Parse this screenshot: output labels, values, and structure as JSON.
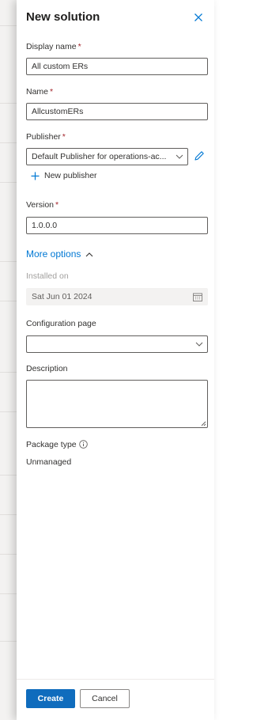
{
  "panel": {
    "title": "New solution",
    "close_icon": "close-icon"
  },
  "form": {
    "display_name": {
      "label": "Display name",
      "required": "*",
      "value": "All custom ERs"
    },
    "name": {
      "label": "Name",
      "required": "*",
      "value": "AllcustomERs"
    },
    "publisher": {
      "label": "Publisher",
      "required": "*",
      "value": "Default Publisher for operations-ac..."
    },
    "new_publisher": "New publisher",
    "version": {
      "label": "Version",
      "required": "*",
      "value": "1.0.0.0"
    },
    "more_options": "More options",
    "installed_on": {
      "label": "Installed on",
      "value": "Sat Jun 01 2024"
    },
    "configuration_page": {
      "label": "Configuration page",
      "value": ""
    },
    "description": {
      "label": "Description",
      "value": ""
    },
    "package_type": {
      "label": "Package type",
      "value": "Unmanaged"
    }
  },
  "footer": {
    "create": "Create",
    "cancel": "Cancel"
  },
  "colors": {
    "accent": "#0f6cbd",
    "link": "#0078d4",
    "required": "#a4262c"
  }
}
